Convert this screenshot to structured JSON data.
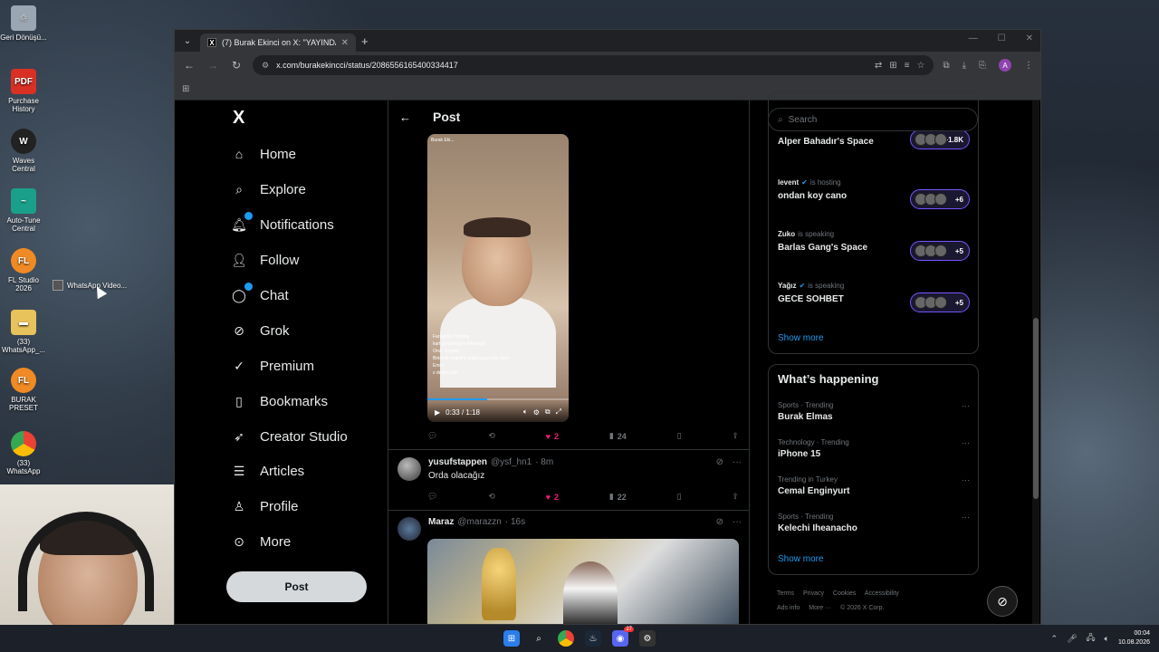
{
  "desktop": {
    "icons": [
      {
        "label": "Geri Dönüşü...",
        "icon": "recycle-bin-icon"
      },
      {
        "label": "Purchase History",
        "icon": "pdf-icon"
      },
      {
        "label": "Waves Central",
        "icon": "waves-icon"
      },
      {
        "label": "Auto-Tune Central",
        "icon": "autotune-icon"
      },
      {
        "label": "FL Studio 2026",
        "icon": "fl-studio-icon"
      },
      {
        "label": "(33) WhatsApp_...",
        "icon": "folder-icon"
      },
      {
        "label": "BURAK PRESET",
        "icon": "fl-studio-icon"
      },
      {
        "label": "(33) WhatsApp",
        "icon": "chrome-icon"
      }
    ],
    "file_label": "WhatsApp Video..."
  },
  "browser": {
    "tab_title": "(7) Burak Ekinci on X: \"YAYINDA",
    "url": "x.com/burakekincci/status/2086556165400334417"
  },
  "x": {
    "logo": "X",
    "nav": [
      {
        "label": "Home",
        "icon": "home-icon"
      },
      {
        "label": "Explore",
        "icon": "search-icon"
      },
      {
        "label": "Notifications",
        "icon": "bell-icon"
      },
      {
        "label": "Follow",
        "icon": "follow-icon"
      },
      {
        "label": "Chat",
        "icon": "chat-icon"
      },
      {
        "label": "Grok",
        "icon": "grok-icon"
      },
      {
        "label": "Premium",
        "icon": "premium-icon"
      },
      {
        "label": "Bookmarks",
        "icon": "bookmark-icon"
      },
      {
        "label": "Creator Studio",
        "icon": "rocket-icon"
      },
      {
        "label": "Articles",
        "icon": "articles-icon"
      },
      {
        "label": "Profile",
        "icon": "profile-icon"
      },
      {
        "label": "More",
        "icon": "more-icon"
      }
    ],
    "post_button": "Post",
    "header_title": "Post",
    "video": {
      "time": "0:33 / 1:18",
      "overlay_name": "Burak Eki...",
      "comments": [
        "Farısplah Postinej",
        "kart görünmüyor tekirdağlı",
        "Onur Soydan",
        "Birisi mi engelimi kaldırsana xale diyor",
        "Emre",
        "x destey bile"
      ],
      "progress": 0.42
    },
    "main_actions": {
      "likes": "2",
      "views": "24"
    },
    "replies": [
      {
        "name": "yusufstappen",
        "handle": "@ysf_hn1",
        "time": "· 8m",
        "text": "Orda olacağız",
        "likes": "2",
        "views": "22"
      },
      {
        "name": "Maraz",
        "handle": "@marazzn",
        "time": "· 16s",
        "text": ""
      }
    ],
    "search_placeholder": "Search",
    "spaces": [
      {
        "host": "",
        "status": "",
        "title": "Alper Bahadır's Space",
        "count": "+1.8K"
      },
      {
        "host": "levent",
        "status": "is hosting",
        "title": "ondan koy cano",
        "count": "+6"
      },
      {
        "host": "Zuko",
        "status": "is speaking",
        "title": "Barlas Gang's Space",
        "count": "+5"
      },
      {
        "host": "Yağız",
        "status": "is speaking",
        "title": "GECE SOHBET",
        "count": "+5"
      }
    ],
    "show_more": "Show more",
    "happening_title": "What’s happening",
    "trends": [
      {
        "meta": "Sports · Trending",
        "name": "Burak Elmas"
      },
      {
        "meta": "Technology · Trending",
        "name": "iPhone 15"
      },
      {
        "meta": "Trending in Turkey",
        "name": "Cemal Enginyurt"
      },
      {
        "meta": "Sports · Trending",
        "name": "Kelechi Iheanacho"
      }
    ],
    "show_more_2": "Show more",
    "footer": [
      "Terms",
      "Privacy",
      "Cookies",
      "Accessibility",
      "Ads info",
      "More ···",
      "© 2026 X Corp."
    ]
  },
  "taskbar": {
    "time": "00:04",
    "date": "10.08.2026",
    "discord_badge": "27"
  }
}
